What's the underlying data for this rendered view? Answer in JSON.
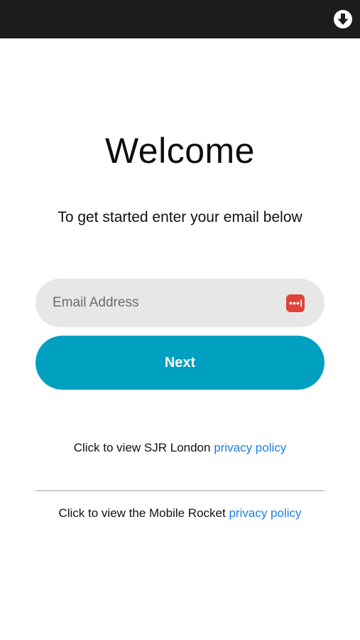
{
  "header": {
    "download_icon": "download-circle-icon"
  },
  "main": {
    "title": "Welcome",
    "subtitle": "To get started enter your email below",
    "email": {
      "placeholder": "Email Address",
      "value": "",
      "autofill_icon": "password-manager-icon"
    },
    "next_label": "Next"
  },
  "footer": {
    "sjr_prefix": "Click to view SJR London",
    "sjr_link": "privacy policy",
    "mr_prefix": "Click to view the Mobile Rocket",
    "mr_link": "privacy policy"
  },
  "colors": {
    "topbar": "#1c1c1c",
    "accent": "#00a0c1",
    "link": "#1a7fe0",
    "input_bg": "#e7e7e7",
    "autofill_icon": "#e0423a"
  }
}
